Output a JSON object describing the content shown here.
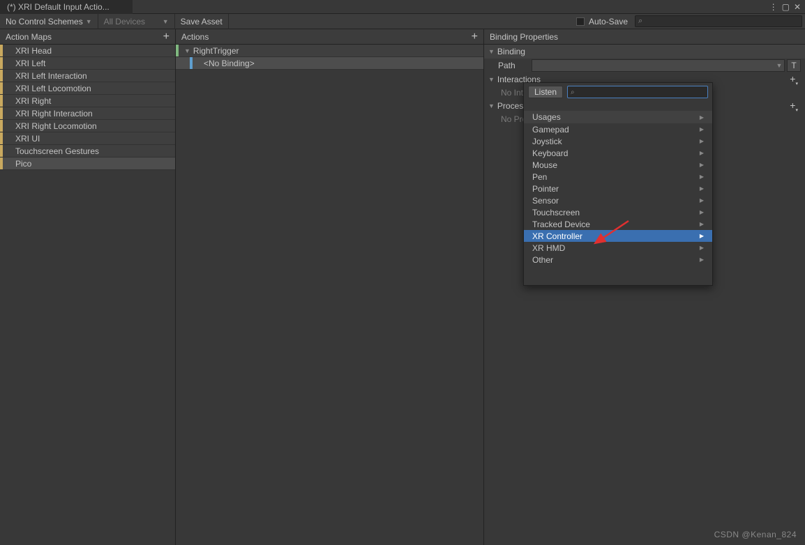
{
  "window": {
    "title": "(*) XRI Default Input Actio..."
  },
  "toolbar": {
    "control_schemes": "No Control Schemes",
    "devices": "All Devices",
    "save_asset": "Save Asset",
    "auto_save": "Auto-Save"
  },
  "panels": {
    "action_maps": "Action Maps",
    "actions": "Actions",
    "binding_properties": "Binding Properties"
  },
  "action_maps": [
    "XRI Head",
    "XRI Left",
    "XRI Left Interaction",
    "XRI Left Locomotion",
    "XRI Right",
    "XRI Right Interaction",
    "XRI Right Locomotion",
    "XRI UI",
    "Touchscreen Gestures",
    "Pico"
  ],
  "selected_map_index": 9,
  "actions": {
    "item": "RightTrigger",
    "binding": "<No Binding>"
  },
  "binding": {
    "section": "Binding",
    "path_label": "Path",
    "t_button": "T",
    "interactions_label": "Interactions",
    "no_interactions": "No Interactions have been added.",
    "processors_label": "Processors",
    "no_processors": "No Processors have been added."
  },
  "dropdown": {
    "listen": "Listen",
    "search_placeholder": "",
    "category": "Usages",
    "items": [
      "Gamepad",
      "Joystick",
      "Keyboard",
      "Mouse",
      "Pen",
      "Pointer",
      "Sensor",
      "Touchscreen",
      "Tracked Device",
      "XR Controller",
      "XR HMD",
      "Other"
    ],
    "highlighted_index": 9
  },
  "watermark": "CSDN @Kenan_824"
}
